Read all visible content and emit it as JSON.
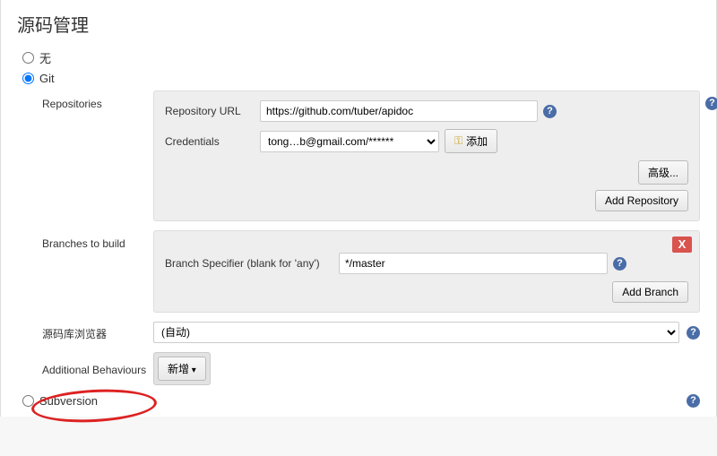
{
  "section": {
    "title": "源码管理"
  },
  "scm": {
    "none_label": "无",
    "git_label": "Git",
    "subversion_label": "Subversion"
  },
  "repos": {
    "heading": "Repositories",
    "url_label": "Repository URL",
    "url_value": "https://github.com/tuber/apidoc",
    "cred_label": "Credentials",
    "cred_selected": "tong…b@gmail.com/******",
    "add_cred_label": "添加",
    "advanced_label": "高级...",
    "add_repo_label": "Add Repository"
  },
  "branches": {
    "heading": "Branches to build",
    "spec_label": "Branch Specifier (blank for 'any')",
    "spec_value": "*/master",
    "add_branch_label": "Add Branch",
    "delete_label": "X"
  },
  "browser": {
    "heading": "源码库浏览器",
    "selected": "(自动)"
  },
  "behaviours": {
    "heading": "Additional Behaviours",
    "add_label": "新增"
  },
  "help": {
    "glyph": "?"
  }
}
